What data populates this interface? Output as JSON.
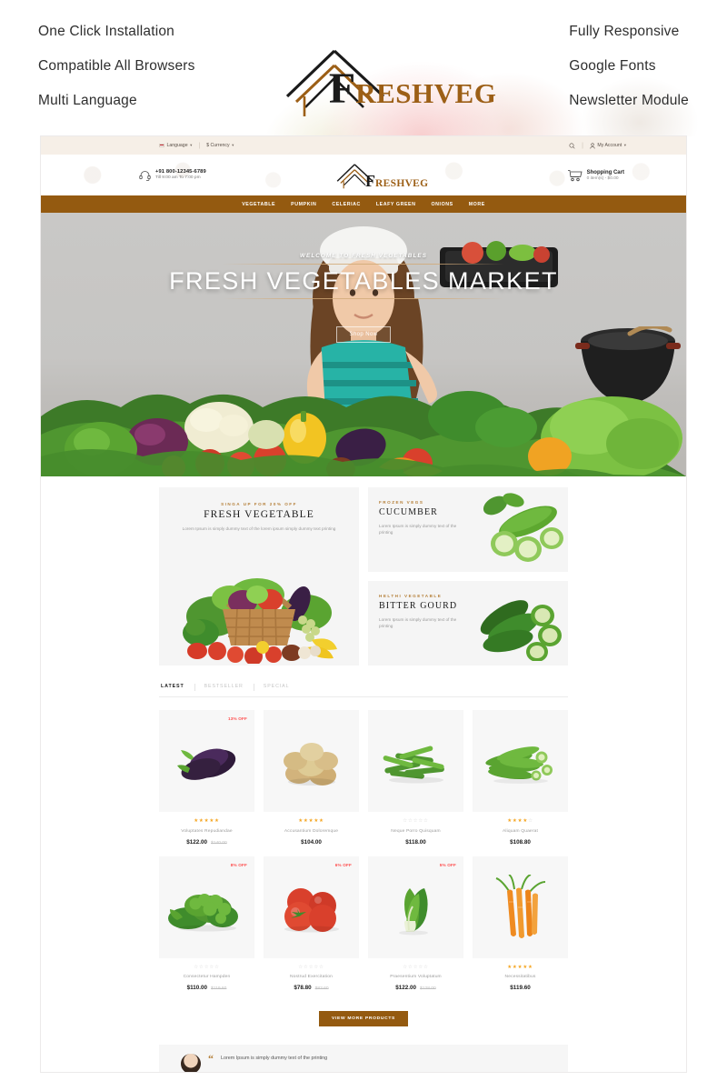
{
  "promo": {
    "left_features": [
      "One Click Installation",
      "Compatible All Browsers",
      "Multi Language"
    ],
    "right_features": [
      "Fully Responsive",
      "Google Fonts",
      "Newsletter Module"
    ],
    "logo": {
      "first_letter": "F",
      "rest": "RESHVEG"
    }
  },
  "site": {
    "topbar": {
      "language_label": "Language",
      "currency_label": "$ Currency",
      "search_icon": "search-icon",
      "account_label": "My Account"
    },
    "header": {
      "phone": "+91 800-12345-6789",
      "hours": "Till 9:00 am To 7:00 pm",
      "logo": {
        "first_letter": "F",
        "rest": "RESHVEG"
      },
      "cart_title": "Shopping Cart",
      "cart_sub": "0 item(s) - $0.00"
    },
    "nav": [
      "VEGETABLE",
      "PUMPKIN",
      "CELERIAC",
      "LEAFY GREEN",
      "ONIONS",
      "MORE"
    ],
    "hero": {
      "subtitle": "WELCOME  TO FRESH VEGETABLES",
      "title": "FRESH  VEGETABLES MARKET",
      "button": "Shop Now"
    },
    "banners": {
      "large": {
        "eyebrow": "SINGA UP FOR 20% OFF",
        "title": "FRESH VEGETABLE",
        "desc": "Lorem Ipsum is simply dummy text of the lorem ipsum simply dummy text printing"
      },
      "small": [
        {
          "eyebrow": "FROZEN VEGS",
          "title": "CUCUMBER",
          "desc": "Lorem Ipsum is simply dummy text of the printing"
        },
        {
          "eyebrow": "HELTHI VEGETABLE",
          "title": "BITTER GOURD",
          "desc": "Lorem Ipsum is simply dummy text of the printing"
        }
      ]
    },
    "tabs": [
      {
        "label": "LATEST",
        "active": true
      },
      {
        "label": "BESTSELLER",
        "active": false
      },
      {
        "label": "SPECIAL",
        "active": false
      }
    ],
    "products": [
      {
        "name": "Voluptates Repudiandae",
        "price": "$122.00",
        "old_price": "$140.00",
        "badge": "13% OFF",
        "rating": 5,
        "image": "eggplant"
      },
      {
        "name": "Accusantium Doloremque",
        "price": "$104.00",
        "old_price": "",
        "badge": "",
        "rating": 5,
        "image": "potato"
      },
      {
        "name": "Neque Porro Quisquam",
        "price": "$118.00",
        "old_price": "",
        "badge": "",
        "rating": 0,
        "image": "green-beans"
      },
      {
        "name": "Aliquam Quaerat",
        "price": "$108.80",
        "old_price": "",
        "badge": "",
        "rating": 4,
        "image": "okra"
      },
      {
        "name": "Consectetur Hampden",
        "price": "$110.00",
        "old_price": "$119.60",
        "badge": "8% OFF",
        "rating": 0,
        "image": "broccoli"
      },
      {
        "name": "Nostrud Exercitation",
        "price": "$78.80",
        "old_price": "$83.60",
        "badge": "6% OFF",
        "rating": 0,
        "image": "tomato"
      },
      {
        "name": "Praesentium Voluptatum",
        "price": "$122.00",
        "old_price": "$128.00",
        "badge": "5% OFF",
        "rating": 0,
        "image": "bok-choy"
      },
      {
        "name": "Necessitatibus",
        "price": "$119.60",
        "old_price": "",
        "badge": "",
        "rating": 5,
        "image": "carrot"
      }
    ],
    "more_button": "VIEW MORE PRODUCTS",
    "testimonial": {
      "text": "Lorem Ipsum is simply dummy text of the printing"
    }
  },
  "colors": {
    "brand_brown": "#945a10",
    "accent_gold": "#b5803a",
    "star": "#f5a623",
    "badge_red": "#ff4d4d"
  }
}
